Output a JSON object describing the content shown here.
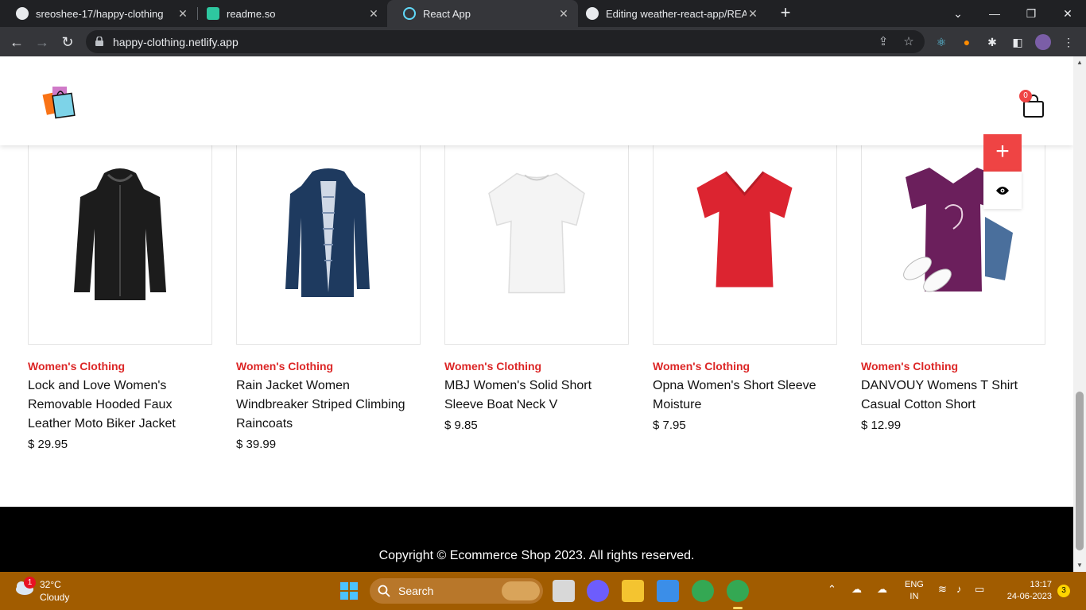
{
  "browser": {
    "tabs": [
      {
        "title": "sreoshee-17/happy-clothing",
        "icon": "github-icon"
      },
      {
        "title": "readme.so",
        "icon": "readme-icon"
      },
      {
        "title": "React App",
        "icon": "react-icon"
      },
      {
        "title": "Editing weather-react-app/READM",
        "icon": "github-icon"
      }
    ],
    "url": "happy-clothing.netlify.app"
  },
  "header": {
    "cart_count": "0"
  },
  "products": [
    {
      "category": "Women's Clothing",
      "title": "Lock and Love Women's Removable Hooded Faux Leather Moto Biker Jacket",
      "price": "$ 29.95"
    },
    {
      "category": "Women's Clothing",
      "title": "Rain Jacket Women Windbreaker Striped Climbing Raincoats",
      "price": "$ 39.99"
    },
    {
      "category": "Women's Clothing",
      "title": "MBJ Women's Solid Short Sleeve Boat Neck V",
      "price": "$ 9.85"
    },
    {
      "category": "Women's Clothing",
      "title": "Opna Women's Short Sleeve Moisture",
      "price": "$ 7.95"
    },
    {
      "category": "Women's Clothing",
      "title": "DANVOUY Womens T Shirt Casual Cotton Short",
      "price": "$ 12.99"
    }
  ],
  "footer": {
    "copyright": "Copyright © Ecommerce Shop 2023. All rights reserved."
  },
  "taskbar": {
    "weather_temp": "32°C",
    "weather_cond": "Cloudy",
    "weather_badge": "1",
    "search_label": "Search",
    "lang_top": "ENG",
    "lang_bottom": "IN",
    "time": "13:17",
    "date": "24-06-2023",
    "notification_count": "3"
  },
  "colors": {
    "accent": "#ef4444",
    "category": "#dc2626",
    "taskbar": "#a15c00"
  }
}
